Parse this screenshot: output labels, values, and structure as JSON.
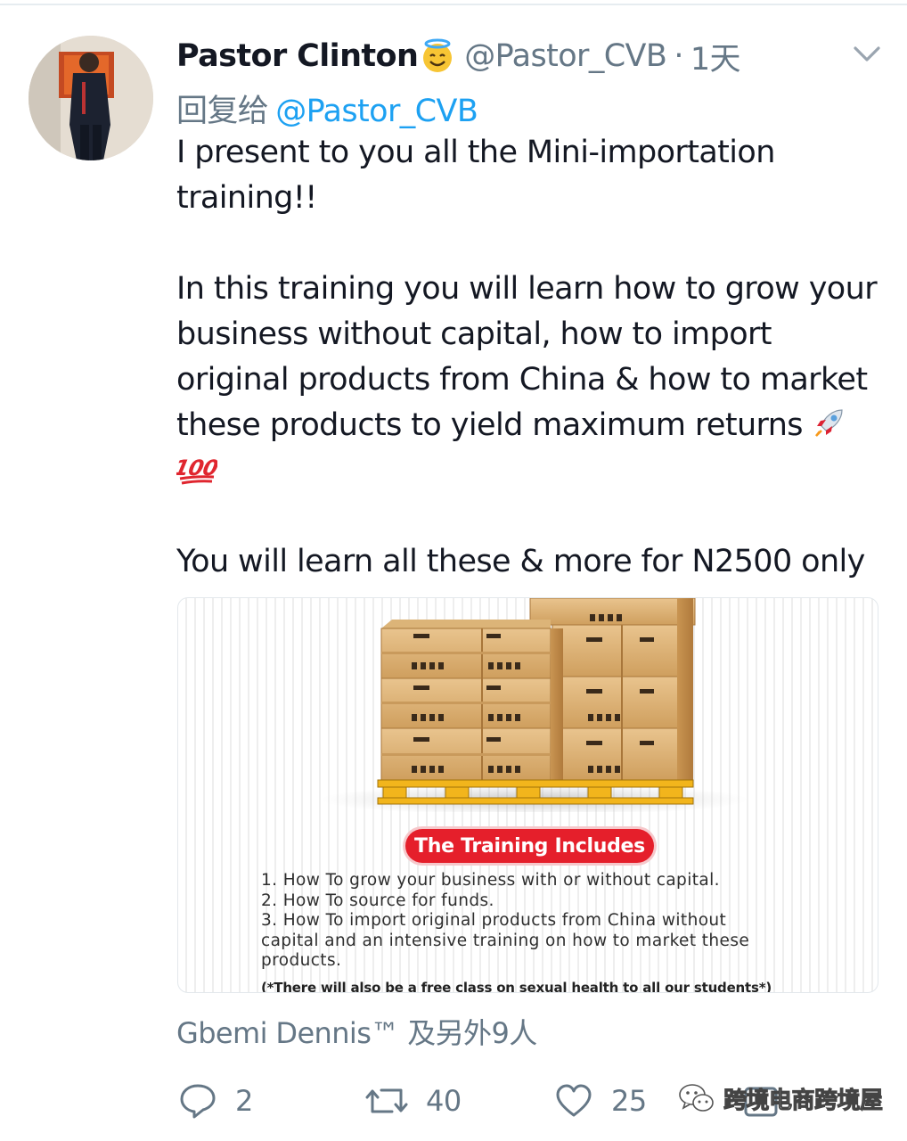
{
  "tweet": {
    "author_name": "Pastor Clinton",
    "author_handle": "@Pastor_CVB",
    "separator": "·",
    "timestamp": "1天",
    "reply_prefix": "回复给",
    "reply_to": "@Pastor_CVB",
    "body_lines": [
      "I present to you all the Mini-importation",
      "training!!",
      "In this training you will learn how to grow your",
      "business without capital, how to import",
      "original products from China & how to market",
      "these products to yield maximum returns",
      "You will learn all these & more for N2500 only"
    ]
  },
  "media": {
    "badge": "The Training Includes",
    "list": [
      "1. How To grow your business with or without capital.",
      "2. How To source for funds.",
      "3. How To import original products from China without",
      "capital and an intensive training on how to market these",
      "products."
    ],
    "footnote": "(*There will also be a free class on sexual health to all our students*)"
  },
  "likes_summary": "Gbemi Dennis™ 及另外9人",
  "actions": {
    "reply_count": "2",
    "retweet_count": "40",
    "like_count": "25"
  },
  "watermark": "跨境电商跨境屋",
  "icons": [
    "avatar-photo",
    "halo-smile-emoji",
    "chevron-down-icon",
    "rocket-emoji",
    "hundred-points-emoji",
    "reply-icon",
    "retweet-icon",
    "heart-icon",
    "share-icon",
    "wechat-icon"
  ],
  "colors": {
    "link": "#1da1f2",
    "muted": "#657786",
    "badge": "#e51f2b"
  }
}
